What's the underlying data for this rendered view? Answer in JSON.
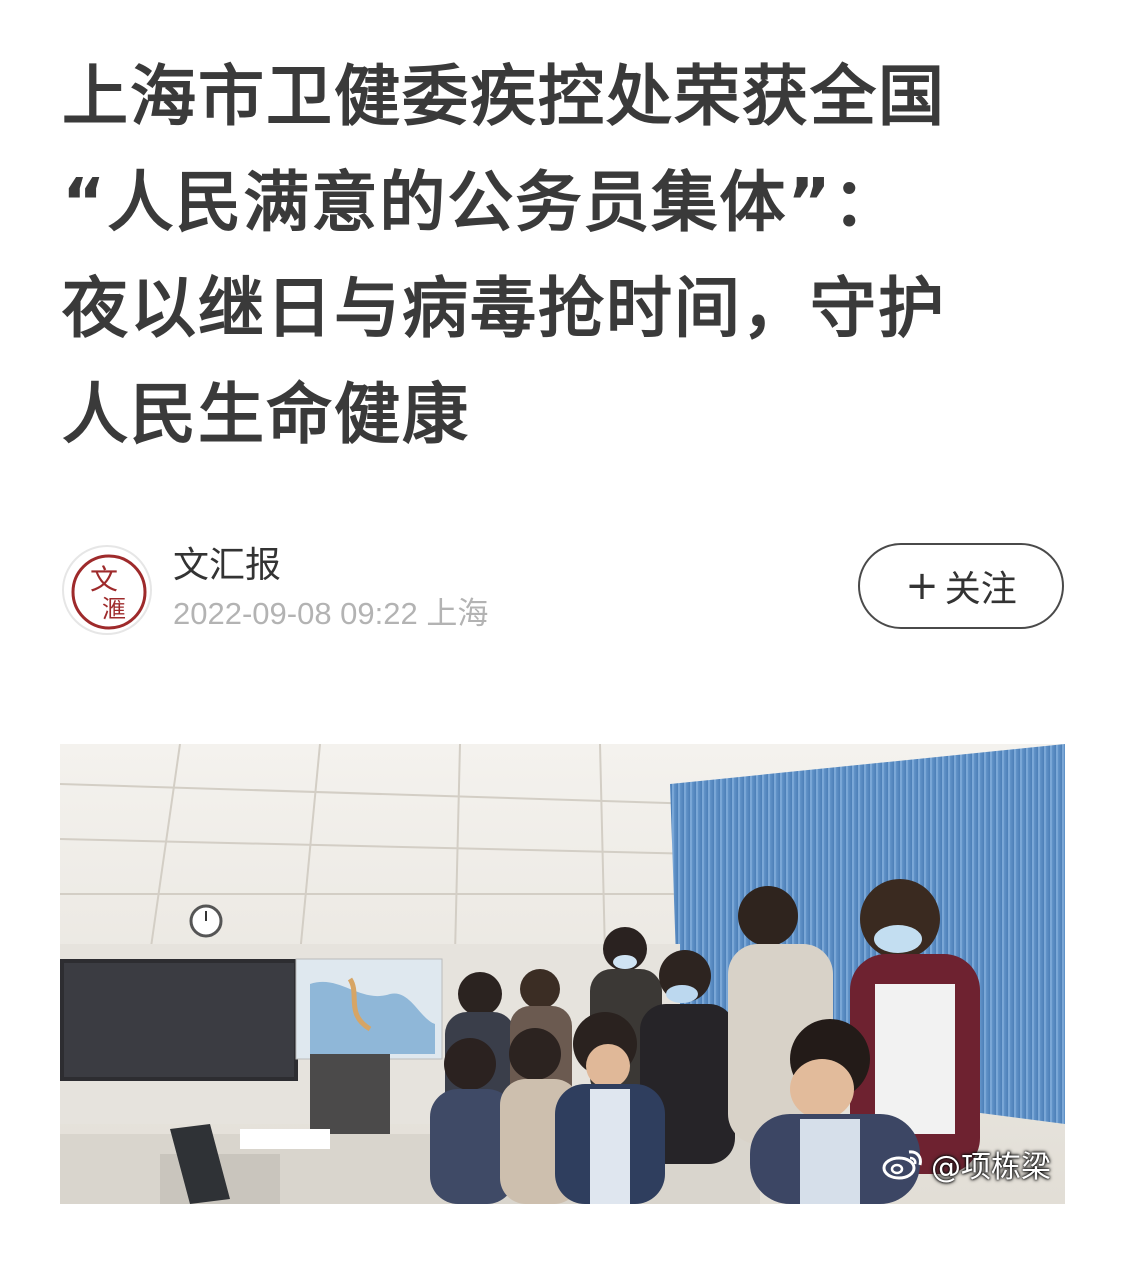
{
  "article": {
    "title_lines": [
      "上海市卫健委疾控处荣获全国",
      "“人民满意的公务员集体”：",
      "夜以继日与病毒抢时间，守护",
      "人民生命健康"
    ]
  },
  "author": {
    "name": "文汇报",
    "logo_chars": [
      "文",
      "滙"
    ],
    "timestamp": "2022-09-08 09:22",
    "location": "上海",
    "follow_label": "关注",
    "follow_prefix": "+"
  },
  "watermark": {
    "text": "@项栋梁",
    "icon": "weibo-icon"
  },
  "colors": {
    "title": "#3a3a3a",
    "meta": "#b3b3b3",
    "logo_red": "#9e2a2b",
    "blinds_blue": "#5b8fc7"
  }
}
